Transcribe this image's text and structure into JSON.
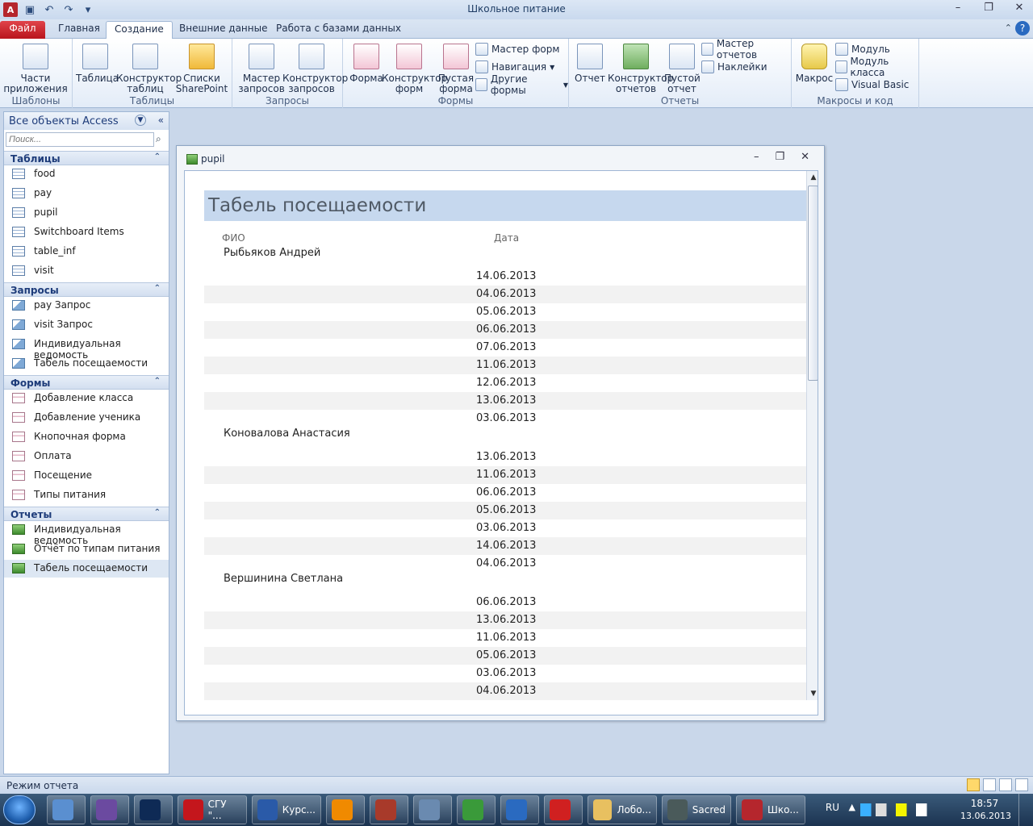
{
  "window": {
    "title": "Школьное питание"
  },
  "tabs": [
    {
      "label": "Файл"
    },
    {
      "label": "Главная"
    },
    {
      "label": "Создание"
    },
    {
      "label": "Внешние данные"
    },
    {
      "label": "Работа с базами данных"
    }
  ],
  "ribbon": {
    "templates": {
      "label": "Шаблоны",
      "parts": "Части\nприложения"
    },
    "tables": {
      "label": "Таблицы",
      "table": "Таблица",
      "designer": "Конструктор\nтаблиц",
      "sharepoint": "Списки\nSharePoint"
    },
    "queries": {
      "label": "Запросы",
      "wizard": "Мастер\nзапросов",
      "designer": "Конструктор\nзапросов"
    },
    "forms": {
      "label": "Формы",
      "form": "Форма",
      "designer": "Конструктор\nформ",
      "blank": "Пустая\nформа",
      "wizard": "Мастер форм",
      "navigation": "Навигация",
      "other": "Другие формы"
    },
    "reports": {
      "label": "Отчеты",
      "report": "Отчет",
      "designer": "Конструктор\nотчетов",
      "blank": "Пустой\nотчет",
      "wizard": "Мастер отчетов",
      "labels": "Наклейки"
    },
    "macros": {
      "label": "Макросы и код",
      "macro": "Макрос",
      "module": "Модуль",
      "class_module": "Модуль класса",
      "vb": "Visual Basic"
    }
  },
  "nav": {
    "title": "Все объекты Access",
    "search_placeholder": "Поиск...",
    "sections": [
      {
        "title": "Таблицы",
        "items": [
          "food",
          "pay",
          "pupil",
          "Switchboard Items",
          "table_inf",
          "visit"
        ]
      },
      {
        "title": "Запросы",
        "items": [
          "pay Запрос",
          "visit Запрос",
          "Индивидуальная ведомость",
          "Табель посещаемости"
        ]
      },
      {
        "title": "Формы",
        "items": [
          "Добавление класса",
          "Добавление ученика",
          "Кнопочная форма",
          "Оплата",
          "Посещение",
          "Типы питания"
        ]
      },
      {
        "title": "Отчеты",
        "items": [
          "Индивидуальная ведомость",
          "Отчёт по типам питания",
          "Табель посещаемости"
        ]
      }
    ]
  },
  "report_window": {
    "title": "pupil",
    "heading": "Табель посещаемости",
    "col_fio": "ФИО",
    "col_date": "Дата",
    "groups": [
      {
        "name": "Рыбьяков Андрей",
        "dates": [
          "14.06.2013",
          "04.06.2013",
          "05.06.2013",
          "06.06.2013",
          "07.06.2013",
          "11.06.2013",
          "12.06.2013",
          "13.06.2013",
          "03.06.2013"
        ]
      },
      {
        "name": "Коновалова Анастасия",
        "dates": [
          "13.06.2013",
          "11.06.2013",
          "06.06.2013",
          "05.06.2013",
          "03.06.2013",
          "14.06.2013",
          "04.06.2013"
        ]
      },
      {
        "name": "Вершинина Светлана",
        "dates": [
          "06.06.2013",
          "13.06.2013",
          "11.06.2013",
          "05.06.2013",
          "03.06.2013",
          "04.06.2013"
        ]
      }
    ]
  },
  "status": {
    "text": "Режим отчета"
  },
  "taskbar": {
    "buttons": [
      {
        "label": "",
        "icon": "virtualbox-icon",
        "color": "#5a8fd0"
      },
      {
        "label": "",
        "icon": "visual-studio-icon",
        "color": "#6b4aa0"
      },
      {
        "label": "",
        "icon": "photoshop-icon",
        "color": "#0e2a55"
      },
      {
        "label": "СГУ \"...",
        "icon": "opera-icon",
        "color": "#c4161c"
      },
      {
        "label": "Курс...",
        "icon": "word-icon",
        "color": "#2a5aa8"
      },
      {
        "label": "",
        "icon": "vlc-icon",
        "color": "#f08a00"
      },
      {
        "label": "",
        "icon": "game-icon",
        "color": "#a83a2a"
      },
      {
        "label": "",
        "icon": "calculator-icon",
        "color": "#6a8ab0"
      },
      {
        "label": "",
        "icon": "download-icon",
        "color": "#3a9a3a"
      },
      {
        "label": "",
        "icon": "browser-icon",
        "color": "#2a6ac0"
      },
      {
        "label": "",
        "icon": "recorder-icon",
        "color": "#d02020"
      },
      {
        "label": "Лобо...",
        "icon": "folder-icon",
        "color": "#e8c060"
      },
      {
        "label": "Sacred",
        "icon": "sacred-icon",
        "color": "#4a5a5a"
      },
      {
        "label": "Шко...",
        "icon": "access-icon",
        "color": "#b5262d"
      }
    ],
    "lang": "RU",
    "time": "18:57",
    "date": "13.06.2013"
  }
}
